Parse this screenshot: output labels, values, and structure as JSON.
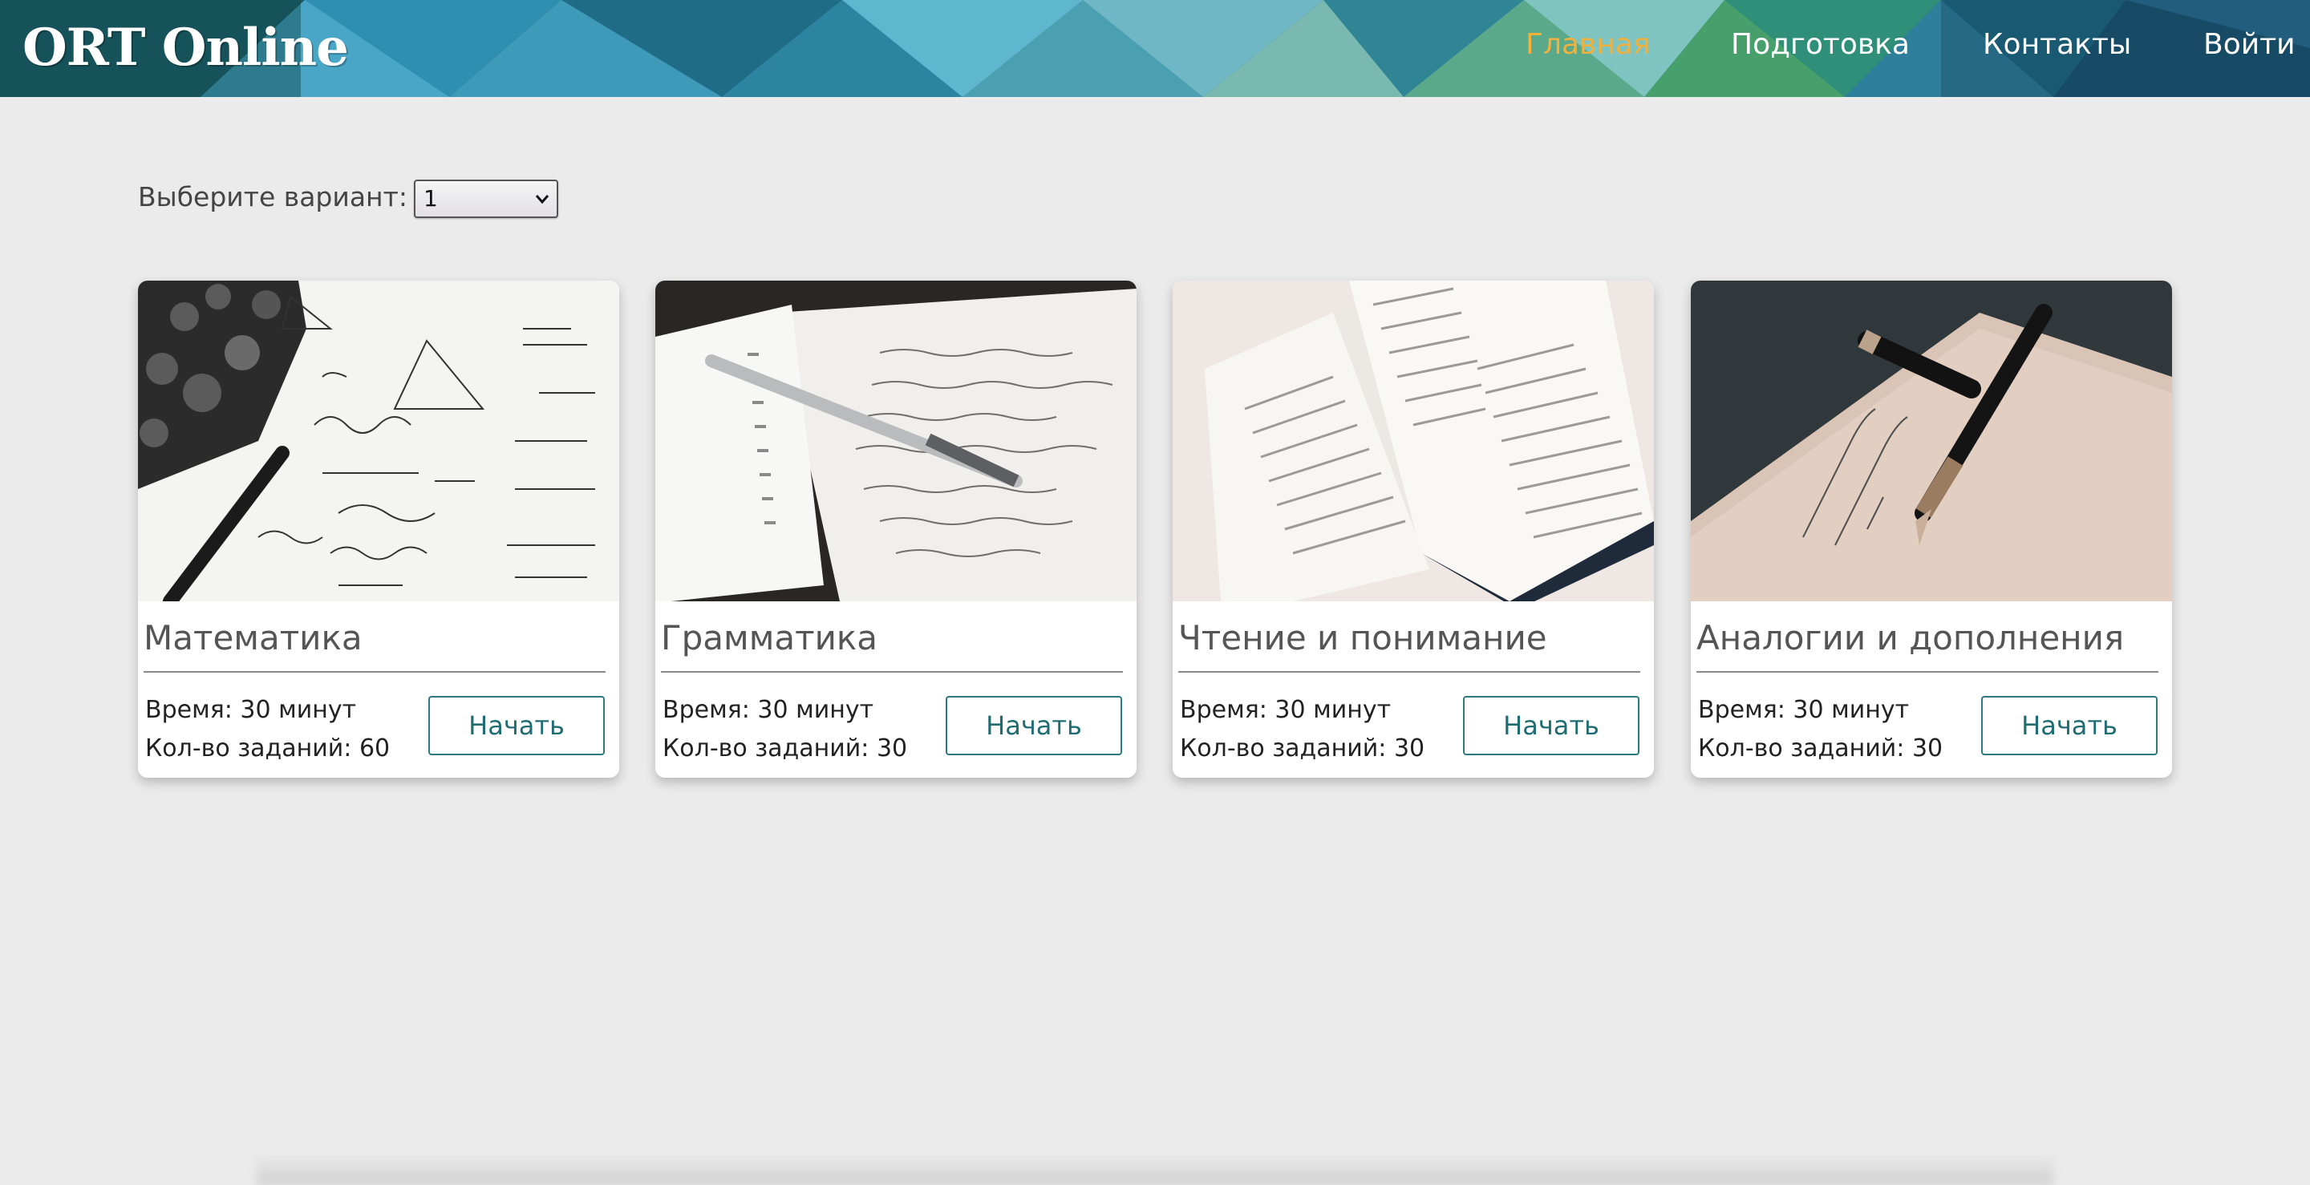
{
  "header": {
    "logo": "ORT Online",
    "nav": [
      {
        "label": "Главная",
        "active": true
      },
      {
        "label": "Подготовка",
        "active": false
      },
      {
        "label": "Контакты",
        "active": false
      },
      {
        "label": "Войти",
        "active": false
      }
    ],
    "active_color": "#f2b13c"
  },
  "variant": {
    "label": "Выберите вариант:",
    "selected": "1"
  },
  "cards": [
    {
      "title": "Математика",
      "time": "Время: 30 минут",
      "count": "Кол-во заданий: 60",
      "button": "Начать",
      "image": "math-formulas-calculator-pen"
    },
    {
      "title": "Грамматика",
      "time": "Время: 30 минут",
      "count": "Кол-во заданий: 30",
      "button": "Начать",
      "image": "notebook-pen"
    },
    {
      "title": "Чтение и понимание",
      "time": "Время: 30 минут",
      "count": "Кол-во заданий: 30",
      "button": "Начать",
      "image": "open-books"
    },
    {
      "title": "Аналогии и дополнения",
      "time": "Время: 30 минут",
      "count": "Кол-во заданий: 30",
      "button": "Начать",
      "image": "fountain-pen-paper"
    }
  ],
  "colors": {
    "accent": "#2b7a7d",
    "background": "#ebebeb"
  }
}
